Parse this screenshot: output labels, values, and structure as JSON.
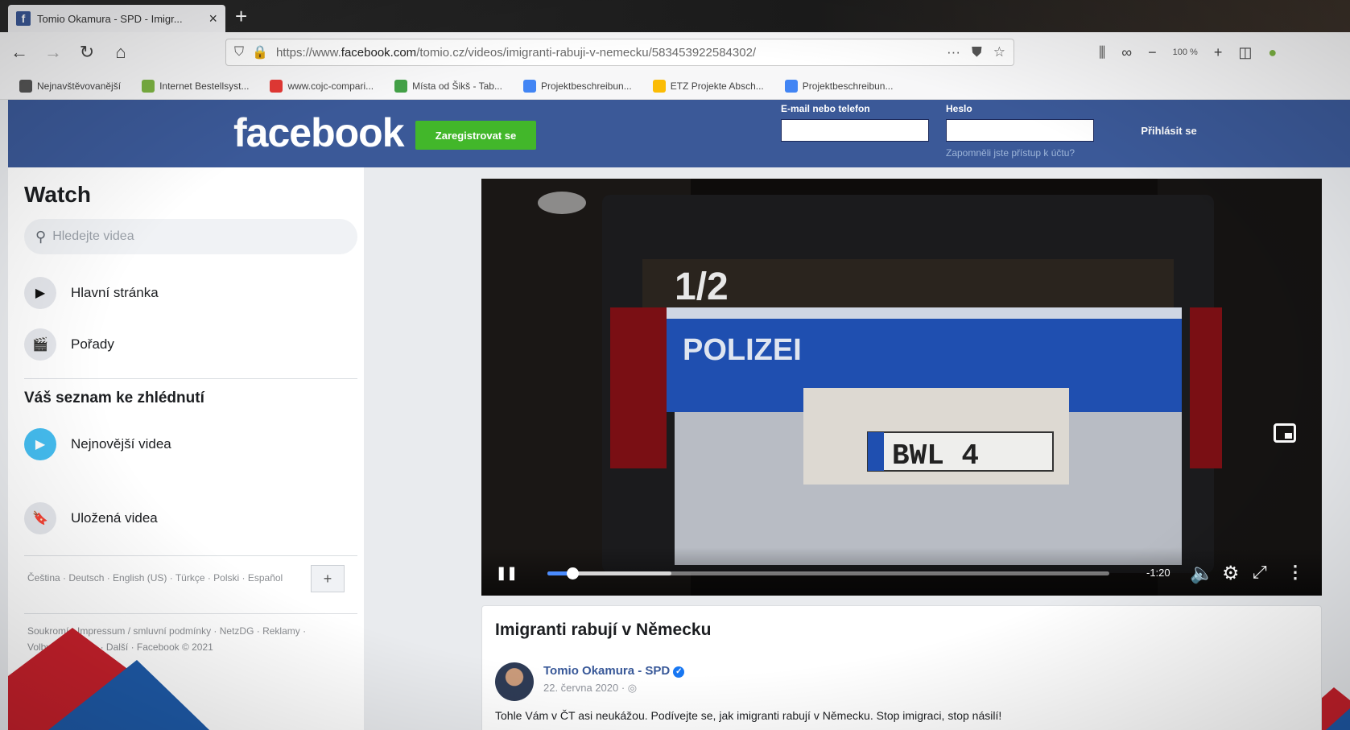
{
  "browser": {
    "tab_title": "Tomio Okamura - SPD - Imigr...",
    "tab_favicon": "f",
    "url_prefix": "https://www.",
    "url_domain": "facebook.com",
    "url_path": "/tomio.cz/videos/imigranti-rabuji-v-nemecku/583453922584302/",
    "zoom": "100 %",
    "bookmarks": [
      {
        "label": "Nejnavštěvovanější",
        "color": "#555555"
      },
      {
        "label": "Internet Bestellsyst...",
        "color": "#7cb342"
      },
      {
        "label": "www.cojc-compari...",
        "color": "#e53935"
      },
      {
        "label": "Místa od Šikš - Tab...",
        "color": "#43a047"
      },
      {
        "label": "Projektbeschreibun...",
        "color": "#4285f4"
      },
      {
        "label": "ETZ Projekte Absch...",
        "color": "#fbbc05"
      },
      {
        "label": "Projektbeschreibun...",
        "color": "#4285f4"
      }
    ]
  },
  "facebook": {
    "logo": "facebook",
    "register_label": "Zaregistrovat se",
    "email_label": "E-mail nebo telefon",
    "password_label": "Heslo",
    "forgot_label": "Zapomněli jste přístup k účtu?",
    "login_label": "Přihlásit se"
  },
  "sidebar": {
    "title": "Watch",
    "search_placeholder": "Hledejte videa",
    "items": [
      {
        "label": "Hlavní stránka",
        "icon": "play-tv-icon"
      },
      {
        "label": "Pořady",
        "icon": "clapper-icon"
      }
    ],
    "list_title": "Váš seznam ke zhlédnutí",
    "list_items": [
      {
        "label": "Nejnovější videa",
        "icon": "play-circle-icon"
      },
      {
        "label": "Uložená videa",
        "icon": "bookmark-icon"
      }
    ],
    "languages": "Čeština · Deutsch · English (US) · Türkçe · Polski · Español",
    "footer": "Soukromí · Impressum / smluvní podmínky · NetzDG · Reklamy · Volby reklamy ▷ · Další · Facebook © 2021"
  },
  "video": {
    "progress": 0.045,
    "buffered": 0.22,
    "time_left": "-1:20",
    "plate_text": "BWL 4",
    "vehicle_text": "POLIZEI",
    "unit_text": "1/2"
  },
  "post": {
    "title": "Imigranti rabují v Německu",
    "author": "Tomio Okamura - SPD",
    "date": "22. června 2020 · ◎",
    "text": "Tohle Vám v ČT asi neukážou. Podívejte se, jak imigranti rabují v Německu. Stop imigraci, stop násilí!"
  },
  "colors": {
    "fb_blue": "#3b5998",
    "fb_green": "#42b72a",
    "police_blue": "#1f4fb0"
  }
}
